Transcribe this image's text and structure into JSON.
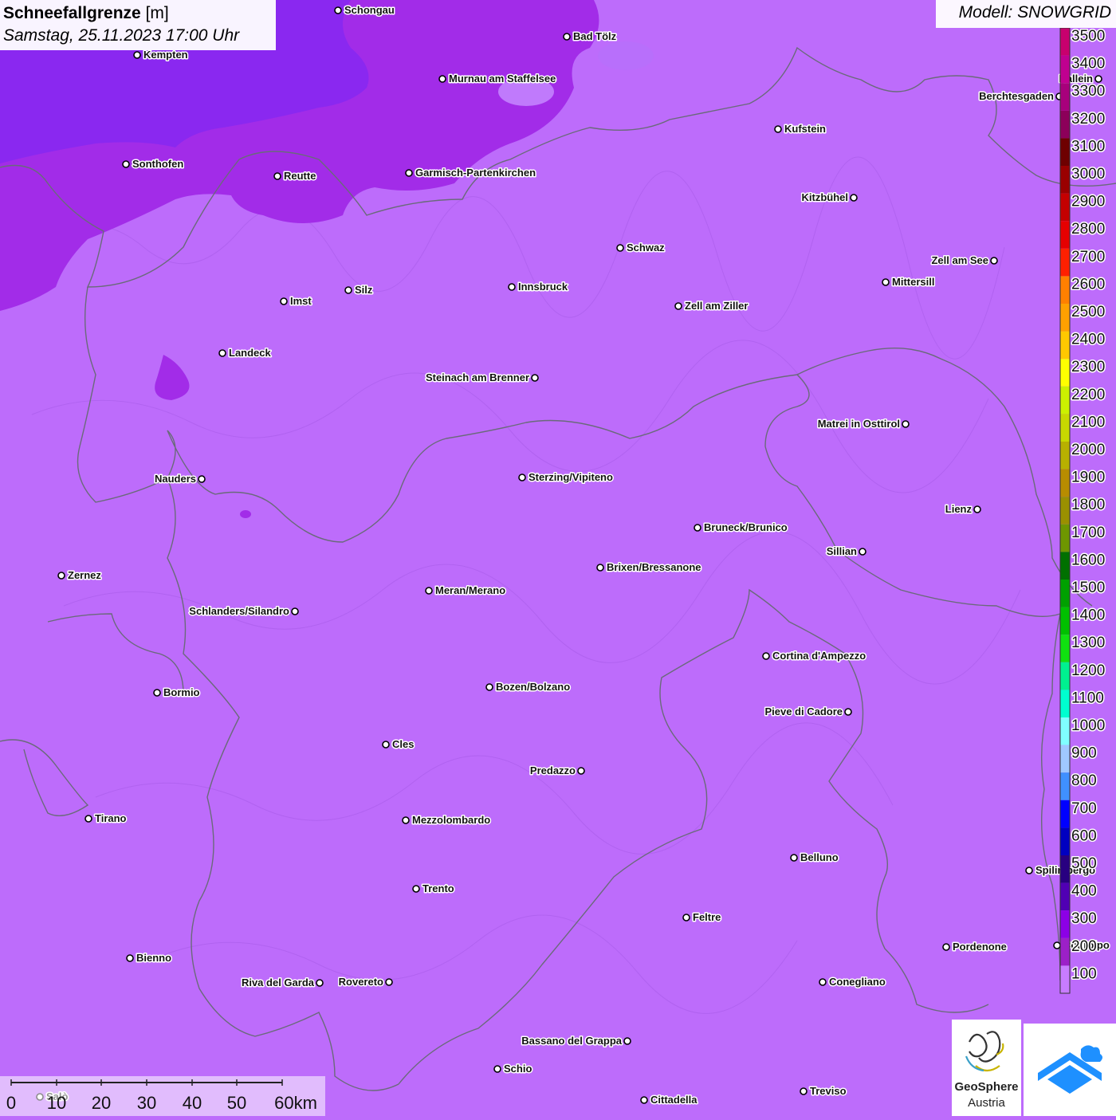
{
  "title": {
    "main": "Schneefallgrenze",
    "unit": "[m]",
    "datetime": "Samstag, 25.11.2023 17:00 Uhr"
  },
  "model": "Modell: SNOWGRID",
  "legend": {
    "levels": [
      "3500",
      "3400",
      "3300",
      "3200",
      "3100",
      "3000",
      "2900",
      "2800",
      "2700",
      "2600",
      "2500",
      "2400",
      "2300",
      "2200",
      "2100",
      "2000",
      "1900",
      "1800",
      "1700",
      "1600",
      "1500",
      "1400",
      "1300",
      "1200",
      "1100",
      "1000",
      "900",
      "800",
      "700",
      "600",
      "500",
      "400",
      "300",
      "200",
      "100"
    ],
    "colors": [
      "#c8006e",
      "#c00090",
      "#a8007c",
      "#8c005a",
      "#6e0000",
      "#9a0000",
      "#c40000",
      "#e60000",
      "#ff2000",
      "#ff8000",
      "#ffa000",
      "#ffc800",
      "#ffff00",
      "#ccf000",
      "#c8d800",
      "#b8b000",
      "#b88c00",
      "#9a9000",
      "#6e9600",
      "#007000",
      "#00a000",
      "#00c000",
      "#10e010",
      "#00f090",
      "#00ffd0",
      "#80ffff",
      "#a0c8ff",
      "#4090ff",
      "#0000ff",
      "#0000c0",
      "#280080",
      "#5000b4",
      "#8c00e6",
      "#9c20c8",
      "#c87cff"
    ]
  },
  "cities": [
    {
      "name": "Schongau",
      "side": "r"
    },
    {
      "name": "Bad Tölz",
      "side": "r"
    },
    {
      "name": "Kempten",
      "side": "r"
    },
    {
      "name": "Murnau am Staffelsee",
      "side": "r"
    },
    {
      "name": "Kufstein",
      "side": "r"
    },
    {
      "name": "Berchtesgaden",
      "side": "l"
    },
    {
      "name": "Hallein",
      "side": "l"
    },
    {
      "name": "Sonthofen",
      "side": "r"
    },
    {
      "name": "Reutte",
      "side": "r"
    },
    {
      "name": "Garmisch-Partenkirchen",
      "side": "r"
    },
    {
      "name": "Kitzbühel",
      "side": "l"
    },
    {
      "name": "Schwaz",
      "side": "r"
    },
    {
      "name": "Zell am See",
      "side": "l"
    },
    {
      "name": "Mittersill",
      "side": "r"
    },
    {
      "name": "Innsbruck",
      "side": "r"
    },
    {
      "name": "Silz",
      "side": "r"
    },
    {
      "name": "Imst",
      "side": "r"
    },
    {
      "name": "Zell am Ziller",
      "side": "r"
    },
    {
      "name": "Landeck",
      "side": "r"
    },
    {
      "name": "Steinach am Brenner",
      "side": "l"
    },
    {
      "name": "Matrei in Osttirol",
      "side": "l"
    },
    {
      "name": "Nauders",
      "side": "l"
    },
    {
      "name": "Sterzing/Vipiteno",
      "side": "r"
    },
    {
      "name": "Lienz",
      "side": "l"
    },
    {
      "name": "Bruneck/Brunico",
      "side": "r"
    },
    {
      "name": "Sillian",
      "side": "l"
    },
    {
      "name": "Zernez",
      "side": "r"
    },
    {
      "name": "Brixen/Bressanone",
      "side": "r"
    },
    {
      "name": "Meran/Merano",
      "side": "r"
    },
    {
      "name": "Schlanders/Silandro",
      "side": "l"
    },
    {
      "name": "Cortina d'Ampezzo",
      "side": "r"
    },
    {
      "name": "Bozen/Bolzano",
      "side": "r"
    },
    {
      "name": "Bormio",
      "side": "r"
    },
    {
      "name": "Pieve di Cadore",
      "side": "l"
    },
    {
      "name": "Cles",
      "side": "r"
    },
    {
      "name": "Predazzo",
      "side": "l"
    },
    {
      "name": "Tirano",
      "side": "r"
    },
    {
      "name": "Mezzolombardo",
      "side": "r"
    },
    {
      "name": "Belluno",
      "side": "r"
    },
    {
      "name": "Spilimbergo",
      "side": "r"
    },
    {
      "name": "Trento",
      "side": "r"
    },
    {
      "name": "Feltre",
      "side": "r"
    },
    {
      "name": "Pordenone",
      "side": "r"
    },
    {
      "name": "Codroipo",
      "side": "r"
    },
    {
      "name": "Bienno",
      "side": "r"
    },
    {
      "name": "Riva del Garda",
      "side": "l"
    },
    {
      "name": "Rovereto",
      "side": "l"
    },
    {
      "name": "Conegliano",
      "side": "r"
    },
    {
      "name": "Bassano del Grappa",
      "side": "l"
    },
    {
      "name": "Schio",
      "side": "r"
    },
    {
      "name": "Salò",
      "side": "r"
    },
    {
      "name": "Treviso",
      "side": "r"
    },
    {
      "name": "Cittadella",
      "side": "r"
    }
  ],
  "scale": {
    "ticks": [
      "0",
      "10",
      "20",
      "30",
      "40",
      "50"
    ],
    "last": "60km"
  },
  "logos": {
    "geosphere_line1": "GeoSphere",
    "geosphere_line2": "Austria"
  },
  "colors": {
    "background": "#bd6cfb",
    "zone_200": "#a22ce8",
    "zone_300": "#8a28f0",
    "border": "#6a6a7a"
  }
}
